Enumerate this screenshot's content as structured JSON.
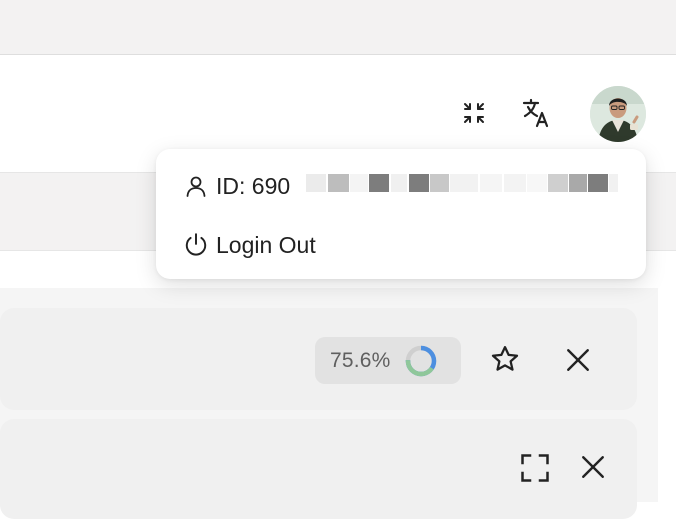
{
  "header": {
    "fullscreen_icon": "fullscreen-exit-icon",
    "translate_icon": "translate-icon",
    "avatar_icon": "user-avatar"
  },
  "dropdown": {
    "id_label": "ID: 690",
    "logout_label": "Login Out",
    "user_icon": "user-icon",
    "power_icon": "power-icon"
  },
  "task_card": {
    "progress_text": "75.6%",
    "progress_value": 0.756,
    "star_icon": "star-icon",
    "close_icon": "close-icon"
  },
  "second_card": {
    "expand_icon": "expand-icon",
    "close_icon": "close-icon"
  },
  "colors": {
    "ring_green": "#8fc79a",
    "ring_blue": "#4d8fe0",
    "ring_track": "#cfcfcf"
  }
}
